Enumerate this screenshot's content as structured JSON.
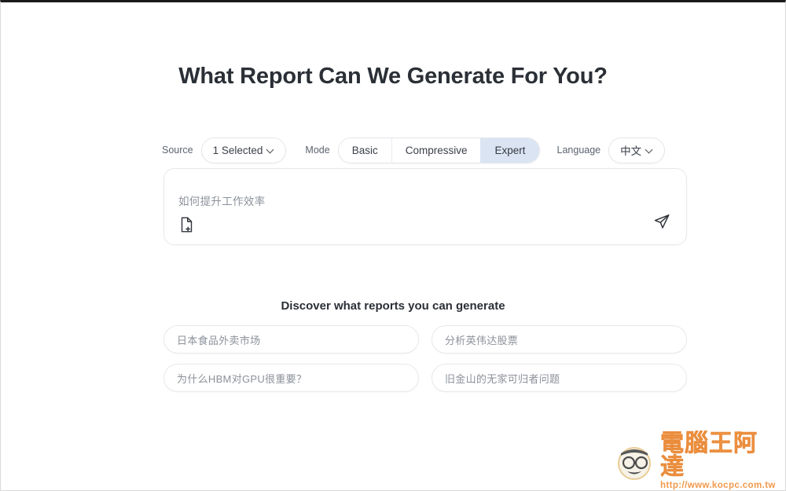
{
  "page": {
    "title": "What Report Can We Generate For You?"
  },
  "toolbar": {
    "source_label": "Source",
    "source_value": "1 Selected",
    "source_chevron_icon": "chevron-down-icon",
    "mode_label": "Mode",
    "mode_options": [
      {
        "label": "Basic",
        "selected": false
      },
      {
        "label": "Compressive",
        "selected": false
      },
      {
        "label": "Expert",
        "selected": true
      }
    ],
    "mode_selected": "Expert",
    "language_label": "Language",
    "language_value": "中文",
    "language_chevron_icon": "chevron-down-icon",
    "selected_color": "#dae4f2"
  },
  "composer": {
    "placeholder": "如何提升工作效率",
    "value": "",
    "attach_icon": "file-add-icon",
    "send_icon": "send-paper-plane-icon"
  },
  "discover": {
    "heading": "Discover what reports you can generate",
    "suggestions": [
      {
        "label": "日本食品外卖市场"
      },
      {
        "label": "分析英伟达股票"
      },
      {
        "label": "为什么HBM对GPU很重要？"
      },
      {
        "label": "旧金山的无家可归者问题"
      }
    ]
  },
  "watermark": {
    "brand": "電腦王阿達",
    "url": "http://www.kocpc.com.tw",
    "color": "#f0913c"
  }
}
